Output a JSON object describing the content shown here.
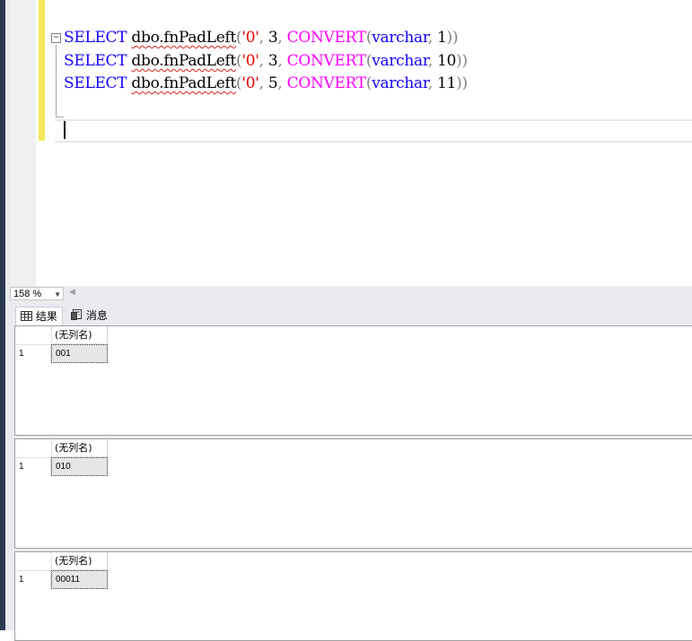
{
  "editor": {
    "lines": [
      {
        "kw": "SELECT",
        "fn": "dbo.fnPadLeft",
        "open": "(",
        "str": "'0'",
        "c1": ",",
        "num1": "3",
        "c2": ",",
        "builtin": "CONVERT",
        "open2": "(",
        "type": "varchar",
        "c3": ",",
        "num2": "1",
        "close": "))"
      },
      {
        "kw": "SELECT",
        "fn": "dbo.fnPadLeft",
        "open": "(",
        "str": "'0'",
        "c1": ",",
        "num1": "3",
        "c2": ",",
        "builtin": "CONVERT",
        "open2": "(",
        "type": "varchar",
        "c3": ",",
        "num2": "10",
        "close": "))"
      },
      {
        "kw": "SELECT",
        "fn": "dbo.fnPadLeft",
        "open": "(",
        "str": "'0'",
        "c1": ",",
        "num1": "5",
        "c2": ",",
        "builtin": "CONVERT",
        "open2": "(",
        "type": "varchar",
        "c3": ",",
        "num2": "11",
        "close": "))"
      }
    ],
    "collapse_glyph": "−"
  },
  "zoom": {
    "value": "158 %"
  },
  "tabs": {
    "results": "结果",
    "messages": "消息"
  },
  "result_sets": [
    {
      "column": "(无列名)",
      "row_number": "1",
      "value": "001"
    },
    {
      "column": "(无列名)",
      "row_number": "1",
      "value": "010"
    },
    {
      "column": "(无列名)",
      "row_number": "1",
      "value": "00011"
    }
  ],
  "colors": {
    "keyword": "#1200ff",
    "string": "#e60000",
    "builtin": "#ff00ff",
    "change_bar": "#f3e75a"
  }
}
